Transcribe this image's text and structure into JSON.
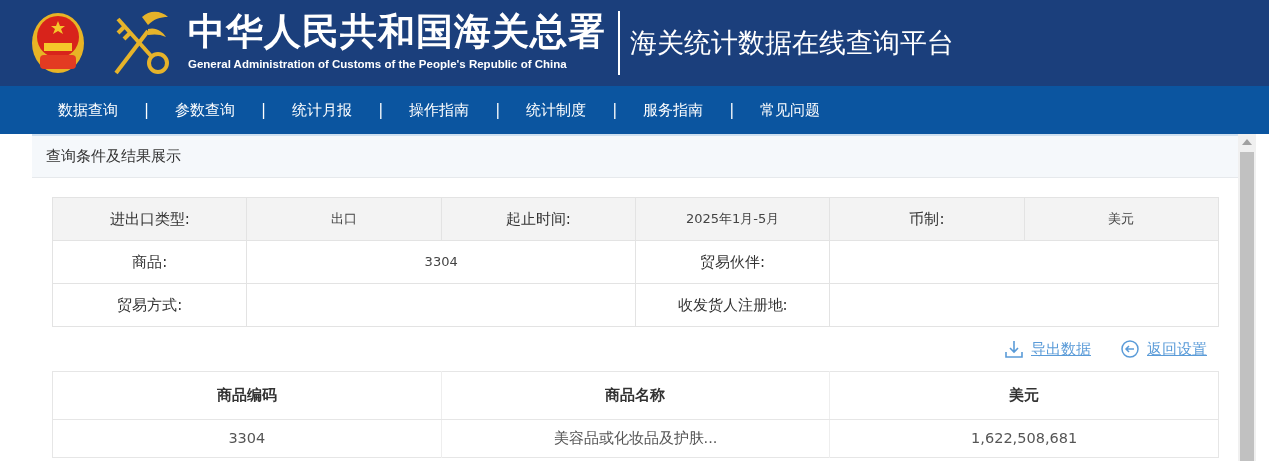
{
  "header": {
    "title": "中华人民共和国海关总署",
    "subtitle": "General Administration of Customs of the People's Republic of China",
    "platform": "海关统计数据在线查询平台"
  },
  "nav": [
    {
      "label": "数据查询",
      "separator": "|"
    },
    {
      "label": "参数查询",
      "separator": "|"
    },
    {
      "label": "统计月报",
      "separator": "|"
    },
    {
      "label": "操作指南",
      "separator": "|"
    },
    {
      "label": "统计制度",
      "separator": "|"
    },
    {
      "label": "服务指南",
      "separator": "|"
    },
    {
      "label": "常见问题"
    }
  ],
  "panel": {
    "title": "查询条件及结果展示"
  },
  "conditions": [
    [
      {
        "kind": "label",
        "text": "进出口类型:"
      },
      {
        "kind": "value",
        "text": "出口"
      },
      {
        "kind": "label",
        "text": "起止时间:"
      },
      {
        "kind": "value",
        "text": "2025年1月-5月"
      },
      {
        "kind": "label",
        "text": "币制:"
      },
      {
        "kind": "value",
        "text": "美元"
      }
    ],
    [
      {
        "kind": "label",
        "text": "商品:"
      },
      {
        "kind": "value",
        "text": "3304"
      },
      {
        "kind": "label",
        "text": "贸易伙伴:"
      },
      {
        "kind": "value"
      }
    ],
    [
      {
        "kind": "label",
        "text": "贸易方式:"
      },
      {
        "kind": "value"
      },
      {
        "kind": "label",
        "text": "收发货人注册地:"
      },
      {
        "kind": "value"
      }
    ]
  ],
  "actions": [
    {
      "kind": "export",
      "label": "导出数据"
    },
    {
      "kind": "back",
      "label": "返回设置"
    }
  ],
  "results": {
    "columns": [
      "商品编码",
      "商品名称",
      "美元"
    ],
    "rows": [
      [
        "3304",
        "美容品或化妆品及护肤...",
        "1,622,508,681"
      ]
    ]
  }
}
